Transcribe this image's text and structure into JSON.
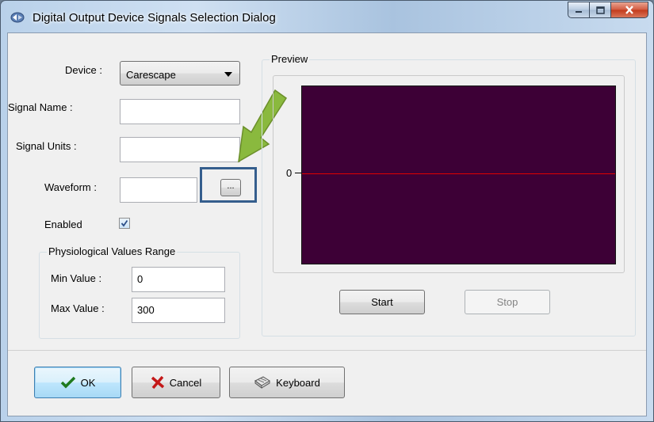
{
  "window": {
    "title": "Digital Output Device Signals Selection Dialog"
  },
  "form": {
    "device_label": "Device :",
    "device_value": "Carescape",
    "signal_name_label": "Signal Name :",
    "signal_name_value": "",
    "signal_units_label": "Signal Units :",
    "signal_units_value": "",
    "waveform_label": "Waveform :",
    "waveform_value": "",
    "browse_label": "...",
    "enabled_label": "Enabled",
    "enabled_checked": true
  },
  "range": {
    "title": "Physiological Values Range",
    "min_label": "Min Value :",
    "min_value": "0",
    "max_label": "Max Value :",
    "max_value": "300"
  },
  "preview": {
    "title": "Preview",
    "y_tick": "0",
    "start_label": "Start",
    "stop_label": "Stop",
    "background_color": "#3d0036",
    "line_color": "#e00000"
  },
  "buttons": {
    "ok": "OK",
    "cancel": "Cancel",
    "keyboard": "Keyboard"
  }
}
